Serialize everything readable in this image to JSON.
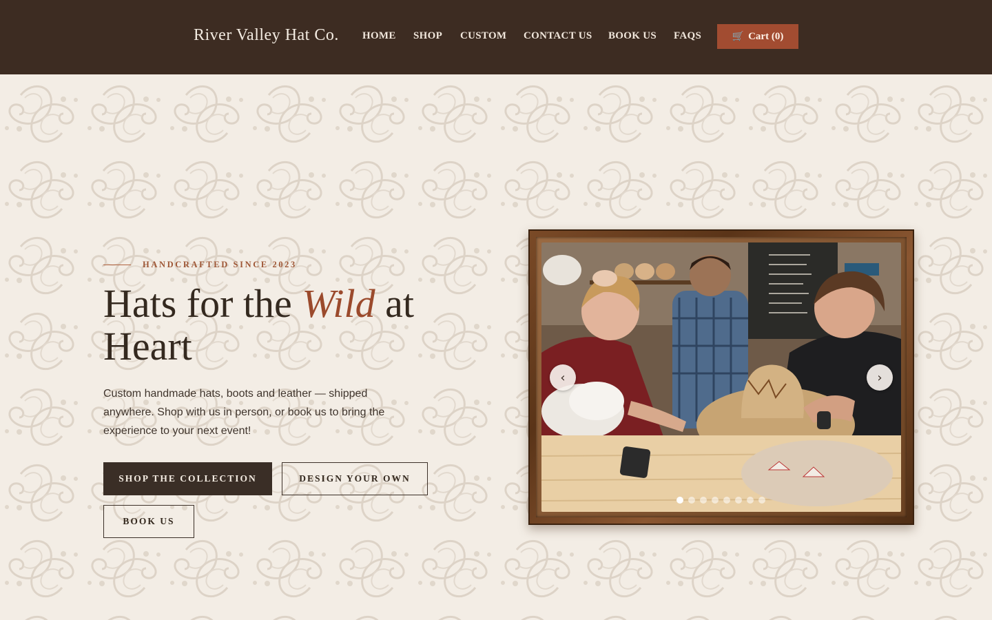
{
  "header": {
    "brand": "River Valley Hat Co.",
    "nav": [
      "HOME",
      "SHOP",
      "CUSTOM",
      "CONTACT US",
      "BOOK US",
      "FAQS"
    ],
    "cart_label": "Cart (0)",
    "cart_icon": "cart-icon"
  },
  "hero": {
    "eyebrow": "HANDCRAFTED SINCE 2023",
    "headline_before": "Hats for the ",
    "headline_emphasis": "Wild",
    "headline_after": " at Heart",
    "lede": "Custom handmade hats, boots and leather — shipped anywhere. Shop with us in person, or book us to bring the experience to your next event!",
    "buttons": {
      "shop": "SHOP THE COLLECTION",
      "design": "DESIGN YOUR OWN",
      "book": "BOOK US"
    }
  },
  "slideshow": {
    "prev_label": "‹",
    "next_label": "›",
    "slide_count": 8,
    "active_slide": 1
  },
  "colors": {
    "header_bg": "#3d2c22",
    "accent": "#a24c31",
    "page_bg": "#f3ede5",
    "dark_button": "#3a2e26"
  }
}
